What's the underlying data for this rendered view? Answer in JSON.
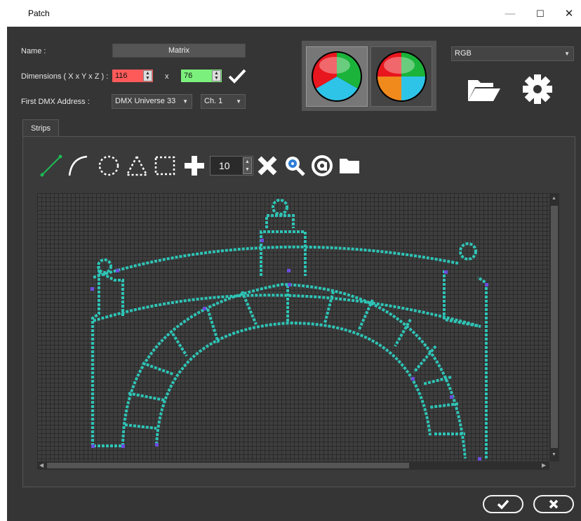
{
  "window": {
    "title": "Patch",
    "minimize": "—",
    "maximize": "☐",
    "close": "✕"
  },
  "form": {
    "name_label": "Name :",
    "name_value": "Matrix",
    "dimensions_label": "Dimensions ( X x Y x Z ) :",
    "dim_x": "116",
    "dim_sep": "x",
    "dim_y": "76",
    "dmx_label": "First DMX Address :",
    "universe": "DMX Universe 33",
    "channel": "Ch. 1",
    "color_mode": "RGB"
  },
  "tabs": [
    {
      "label": "Strips"
    }
  ],
  "toolbar": {
    "point_count": "10"
  },
  "colors": {
    "grid": "#3e3e3e",
    "path": "#2ec4b6",
    "accent": "#6a4cdd"
  },
  "icons": [
    "line-tool-icon",
    "arc-tool-icon",
    "circle-tool-icon",
    "triangle-tool-icon",
    "rectangle-tool-icon",
    "add-icon",
    "delete-icon",
    "zoom-icon",
    "address-icon",
    "folder-icon",
    "open-folder-icon",
    "settings-icon",
    "confirm-icon",
    "cancel-icon"
  ]
}
